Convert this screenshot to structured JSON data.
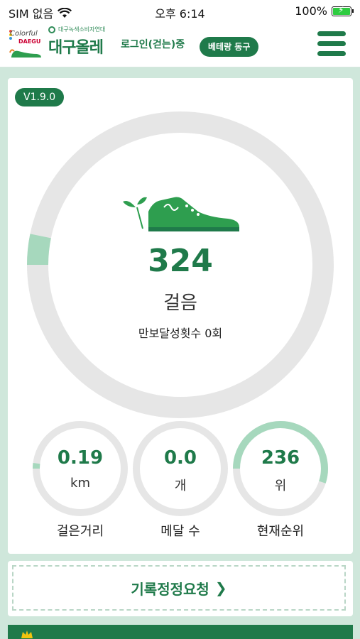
{
  "status_bar": {
    "carrier": "SIM 없음",
    "time": "오후 6:14",
    "battery": "100%"
  },
  "header": {
    "brand_colorful": "Colorful",
    "brand_daegu": "DAEGU",
    "subtitle": "대구녹색소비자연대",
    "app_title": "대구올레",
    "login_status": "로그인(걷는)중",
    "dong_badge": "베테랑 동구"
  },
  "main": {
    "version": "V1.9.0",
    "steps": "324",
    "steps_unit": "걸음",
    "goal_text": "만보달성횟수 0회",
    "steps_goal_fraction": 0.0324,
    "stats": [
      {
        "value": "0.19",
        "unit": "km",
        "label": "걸은거리",
        "fraction": 0.019
      },
      {
        "value": "0.0",
        "unit": "개",
        "label": "메달 수",
        "fraction": 0.0
      },
      {
        "value": "236",
        "unit": "위",
        "label": "현재순위",
        "fraction": 0.55
      }
    ]
  },
  "request": {
    "label": "기록정정요청",
    "chevron": "❯"
  },
  "colors": {
    "primary": "#1f7a4a",
    "accent_light": "#a6d8bd",
    "track": "#e6e6e6",
    "background": "#cfe7db"
  },
  "icons": [
    "wifi-icon",
    "battery-icon",
    "menu-icon",
    "shoe-icon",
    "chevron-right-icon"
  ]
}
